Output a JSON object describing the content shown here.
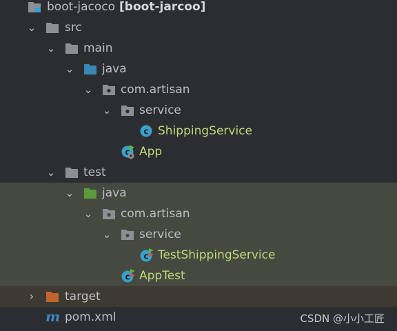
{
  "tree": {
    "root": {
      "name": "boot-jacoco",
      "module": "[boot-jarcoo]"
    },
    "src": "src",
    "main": "main",
    "main_java": "java",
    "main_pkg": "com.artisan",
    "main_service": "service",
    "shipping_service": "ShippingService",
    "app": "App",
    "test": "test",
    "test_java": "java",
    "test_pkg": "com.artisan",
    "test_service": "service",
    "test_shipping_service": "TestShippingService",
    "app_test": "AppTest",
    "target": "target",
    "pom": "pom.xml"
  },
  "icons": {
    "folder_color": "#8c8f94",
    "source_root_color": "#3a87b4",
    "test_root_color": "#5a9a3a",
    "target_color": "#c0642c",
    "class_color": "#3aa0c8",
    "maven_color": "#3f86c7"
  },
  "watermark": "CSDN @小小工匠"
}
